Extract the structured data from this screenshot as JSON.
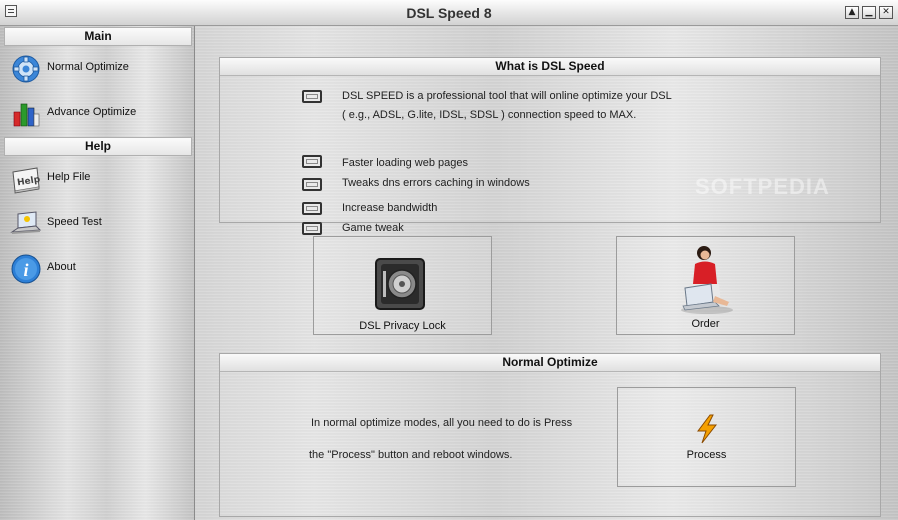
{
  "window": {
    "title": "DSL Speed 8",
    "minimize_glyph": "▲",
    "restore_glyph": "▁",
    "close_glyph": "✕"
  },
  "sidebar": {
    "main_header": "Main",
    "help_header": "Help",
    "items": [
      {
        "label": "Normal Optimize",
        "icon": "gear-icon"
      },
      {
        "label": "Advance Optimize",
        "icon": "colored-bars-icon"
      },
      {
        "label": "Help File",
        "icon": "help-book-icon"
      },
      {
        "label": "Speed Test",
        "icon": "laptop-icon"
      },
      {
        "label": "About",
        "icon": "info-icon"
      }
    ]
  },
  "what_is": {
    "title": "What is DSL Speed",
    "features": [
      {
        "line1": "DSL SPEED is a professional tool that will online optimize your DSL",
        "line2": "( e.g., ADSL, G.lite, IDSL, SDSL ) connection speed to MAX."
      },
      {
        "line1": "Faster loading web pages"
      },
      {
        "line1": "Tweaks dns errors caching in windows"
      },
      {
        "line1": "Increase bandwidth"
      },
      {
        "line1": "Game tweak"
      }
    ]
  },
  "buttons": {
    "privacy_lock": "DSL Privacy Lock",
    "order": "Order",
    "process": "Process"
  },
  "normal_optimize": {
    "title": "Normal Optimize",
    "desc_line1": "In normal optimize modes, all you need to do is Press",
    "desc_line2": "the \"Process\" button and reboot windows."
  },
  "watermark": "SOFTPEDIA",
  "colors": {
    "metal_light": "#e4e4e4",
    "metal_dark": "#bdbdbd",
    "accent_orange": "#f5a000",
    "info_blue": "#2d7fd6"
  }
}
